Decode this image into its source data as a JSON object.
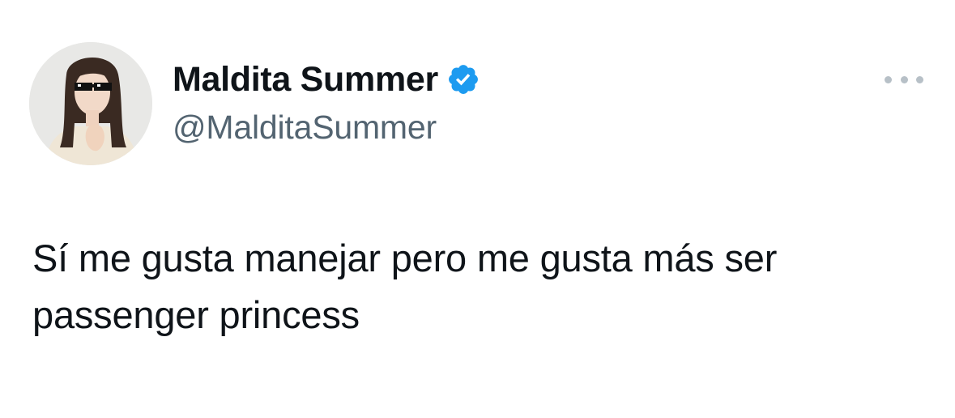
{
  "author": {
    "display_name": "Maldita Summer",
    "handle": "@MalditaSummer",
    "verified": true,
    "verified_color": "#1d9bf0"
  },
  "tweet": {
    "text": "Sí me gusta manejar pero me gusta más ser passenger princess"
  },
  "icons": {
    "verified": "verified-badge-icon",
    "more": "more-options-icon"
  },
  "colors": {
    "text_primary": "#0f1419",
    "text_secondary": "#536471",
    "background": "#ffffff"
  }
}
